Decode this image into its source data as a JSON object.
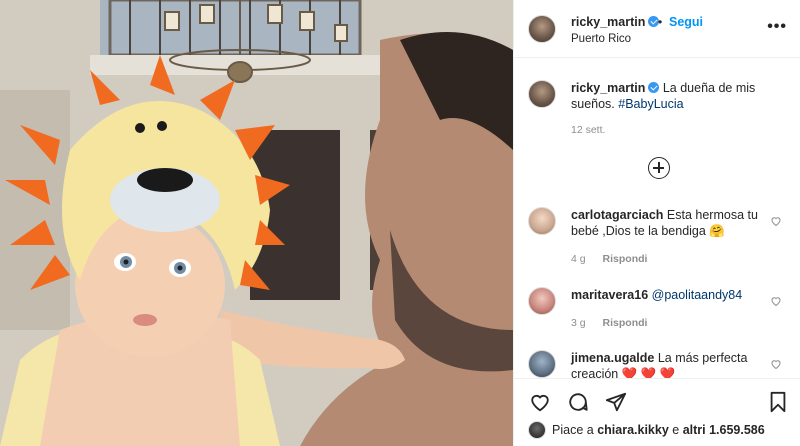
{
  "post": {
    "username": "ricky_martin",
    "separator": "•",
    "follow_label": "Segui",
    "location": "Puerto Rico",
    "more_label": "•••",
    "caption_text": "La dueña de mis sueños.",
    "caption_hashtag": "#BabyLucia",
    "caption_time": "12 sett."
  },
  "comments": [
    {
      "username": "carlotagarciach",
      "text": "Esta hermosa tu bebé ,Dios te la bendiga 🤗",
      "time": "4 g",
      "reply_label": "Rispondi"
    },
    {
      "username": "maritavera16",
      "text": "@paolitaandy84",
      "time": "3 g",
      "reply_label": "Rispondi"
    },
    {
      "username": "jimena.ugalde",
      "text": "La más perfecta creación ❤️ ❤️ ❤️",
      "time": "",
      "reply_label": ""
    }
  ],
  "likes": {
    "prefix": "Piace a",
    "user": "chiara.kikky",
    "middle": "e",
    "others": "altri 1.659.586"
  },
  "icons": {
    "verified": "verified-badge-icon",
    "load_more": "plus-circle-icon",
    "like": "heart-icon",
    "comment": "comment-bubble-icon",
    "share": "paper-plane-icon",
    "save": "bookmark-icon"
  },
  "colors": {
    "link_blue": "#0095f6",
    "verified_blue": "#3897f0",
    "hashtag": "#00376b",
    "muted": "#8e8e8e",
    "lion_orange": "#f06a1f",
    "towel_yellow": "#f5e6a0"
  }
}
